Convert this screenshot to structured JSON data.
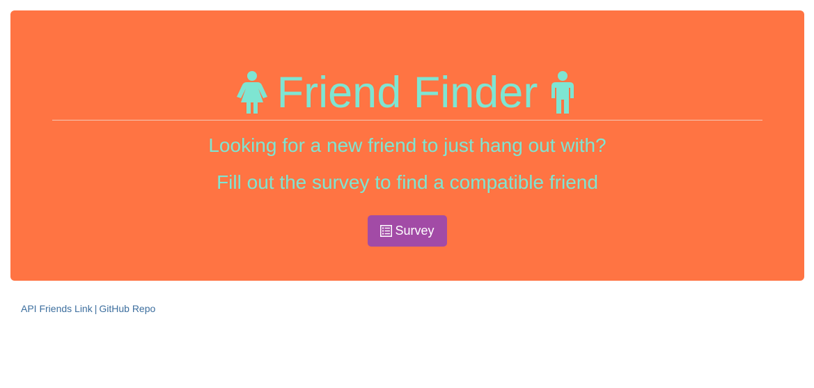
{
  "header": {
    "title": "Friend Finder",
    "left_icon": "female-icon",
    "right_icon": "male-icon",
    "accent_color": "#7ee5d2",
    "background_color": "#ff7443"
  },
  "main": {
    "lead_line_1": "Looking for a new friend to just hang out with?",
    "lead_line_2": "Fill out the survey to find a compatible friend",
    "survey_button": {
      "label": "Survey",
      "icon": "list-alt-icon",
      "color": "#a24ba6"
    }
  },
  "footer": {
    "api_link_label": "API Friends Link",
    "separator": "|",
    "github_link_label": "GitHub Repo",
    "link_color": "#3c6e9e"
  }
}
